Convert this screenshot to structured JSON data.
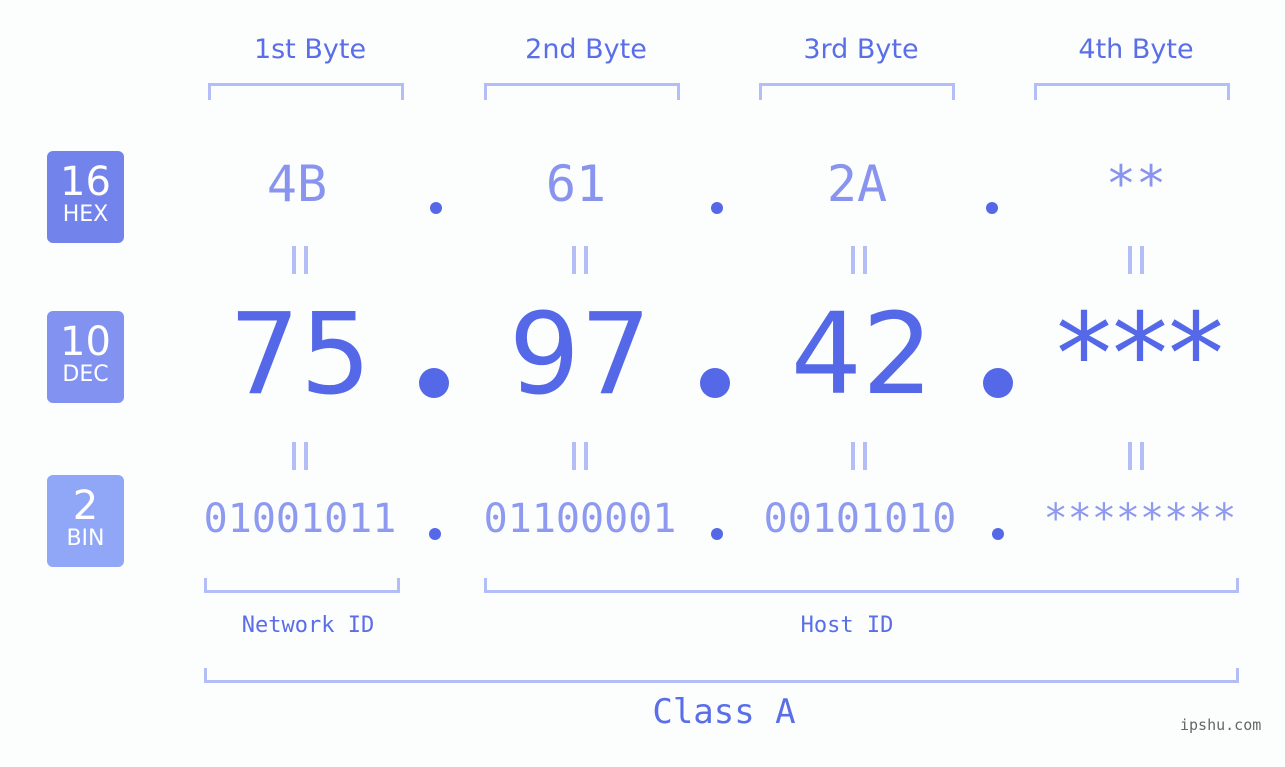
{
  "bytes": [
    {
      "label": "1st Byte",
      "hex": "4B",
      "dec": "75",
      "bin": "01001011"
    },
    {
      "label": "2nd Byte",
      "hex": "61",
      "dec": "97",
      "bin": "01100001"
    },
    {
      "label": "3rd Byte",
      "hex": "2A",
      "dec": "42",
      "bin": "00101010"
    },
    {
      "label": "4th Byte",
      "hex": "**",
      "dec": "***",
      "bin": "********"
    }
  ],
  "badges": {
    "hex": {
      "num": "16",
      "label": "HEX",
      "color": "#7383ec"
    },
    "dec": {
      "num": "10",
      "label": "DEC",
      "color": "#8292f0"
    },
    "bin": {
      "num": "2",
      "label": "BIN",
      "color": "#90a6f6"
    }
  },
  "equals_symbol": "=",
  "network_id_label": "Network ID",
  "host_id_label": "Host ID",
  "class_label": "Class A",
  "watermark": "ipshu.com",
  "colors": {
    "accent": "#5468e8",
    "bracket": "#b3bdf7"
  }
}
